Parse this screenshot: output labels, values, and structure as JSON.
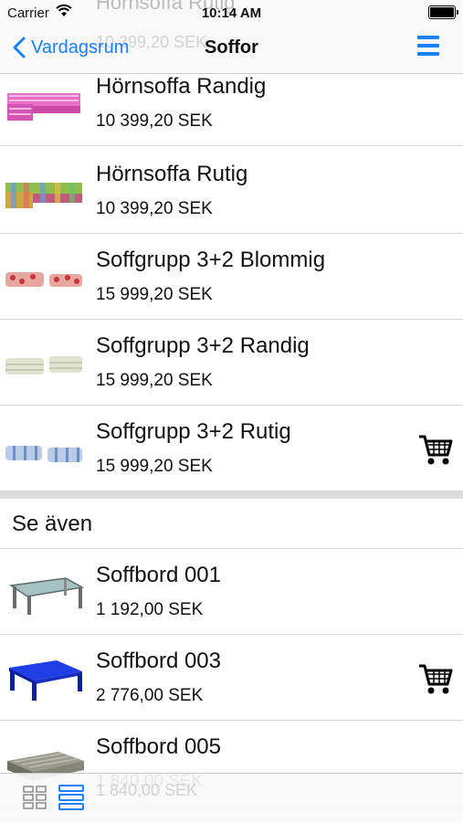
{
  "status_bar": {
    "carrier": "Carrier",
    "time": "10:14 AM"
  },
  "nav": {
    "back_label": "Vardagsrum",
    "title": "Soffor",
    "behind_title": "Hörnsoffa Rutig",
    "behind_price": "10 399,20 SEK"
  },
  "products": [
    {
      "name": "Hörnsoffa Randig",
      "price": "10 399,20 SEK",
      "thumb": "corner-sofa-striped-icon",
      "in_cart": false
    },
    {
      "name": "Hörnsoffa Rutig",
      "price": "10 399,20 SEK",
      "thumb": "corner-sofa-checked-icon",
      "in_cart": false
    },
    {
      "name": "Soffgrupp 3+2 Blommig",
      "price": "15 999,20 SEK",
      "thumb": "sofa-set-floral-icon",
      "in_cart": false
    },
    {
      "name": "Soffgrupp 3+2 Randig",
      "price": "15 999,20 SEK",
      "thumb": "sofa-set-striped-icon",
      "in_cart": false
    },
    {
      "name": "Soffgrupp 3+2 Rutig",
      "price": "15 999,20 SEK",
      "thumb": "sofa-set-checked-icon",
      "in_cart": true
    }
  ],
  "see_also": {
    "heading": "Se även",
    "items": [
      {
        "name": "Soffbord 001",
        "price": "1 192,00 SEK",
        "thumb": "glass-table-icon",
        "in_cart": false
      },
      {
        "name": "Soffbord 003",
        "price": "2 776,00 SEK",
        "thumb": "blue-table-icon",
        "in_cart": true
      },
      {
        "name": "Soffbord 005",
        "price": "1 840,00 SEK",
        "thumb": "wood-table-icon",
        "in_cart": false
      }
    ]
  },
  "toolbar": {
    "grid_icon": "grid-view-icon",
    "list_icon": "list-view-icon"
  },
  "colors": {
    "accent": "#1a7ffb",
    "separator": "#d9d9d9",
    "section_gap": "#dcdcdc"
  }
}
